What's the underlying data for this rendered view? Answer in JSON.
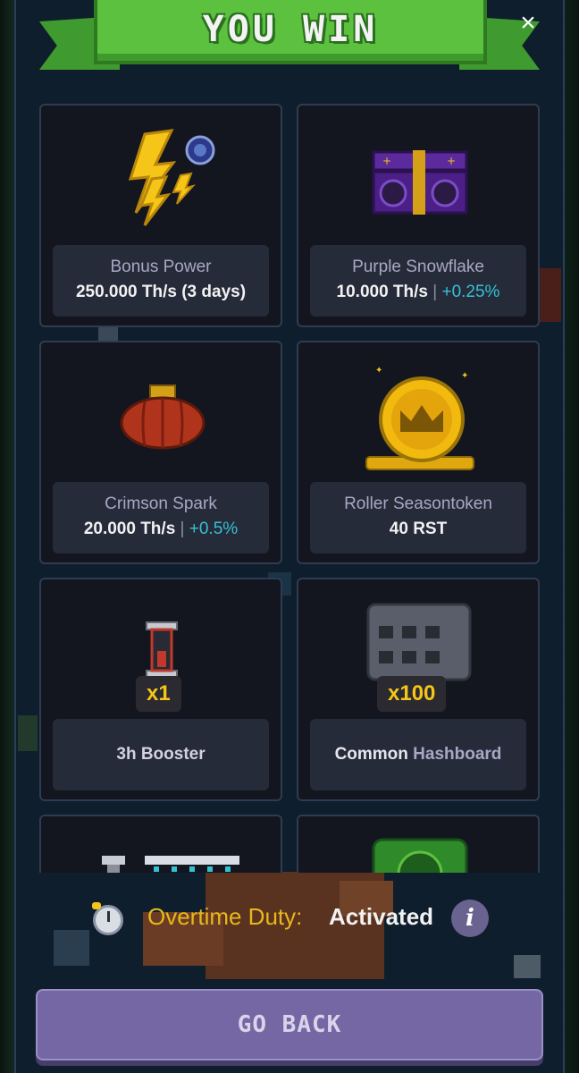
{
  "banner": {
    "title": "YOU WIN",
    "close_label": "×"
  },
  "rewards": [
    {
      "name": "Bonus Power",
      "value": "250.000 Th/s (3 days)",
      "icon": "lightning-bolt-icon"
    },
    {
      "name": "Purple Snowflake",
      "value": "10.000 Th/s",
      "separator": "|",
      "bonus": "+0.25%",
      "icon": "purple-chest-miner-icon"
    },
    {
      "name": "Crimson Spark",
      "value": "20.000 Th/s",
      "separator": "|",
      "bonus": "+0.5%",
      "icon": "crimson-pumpkin-miner-icon"
    },
    {
      "name": "Roller Seasontoken",
      "value": "40 RST",
      "icon": "gold-crown-coin-icon"
    },
    {
      "name": "3h Booster",
      "quantity": "x1",
      "icon": "hourglass-booster-icon"
    },
    {
      "name_prefix": "Common",
      "name_suffix": "Hashboard",
      "quantity": "x100",
      "icon": "hashboard-icon"
    }
  ],
  "overtime": {
    "label": "Overtime Duty:",
    "status": "Activated",
    "info_label": "i"
  },
  "go_back_label": "GO BACK",
  "colors": {
    "accent_cyan": "#35c1d4",
    "gold": "#e7b81b",
    "button": "#7467a3",
    "banner_green": "#5cc13e"
  }
}
